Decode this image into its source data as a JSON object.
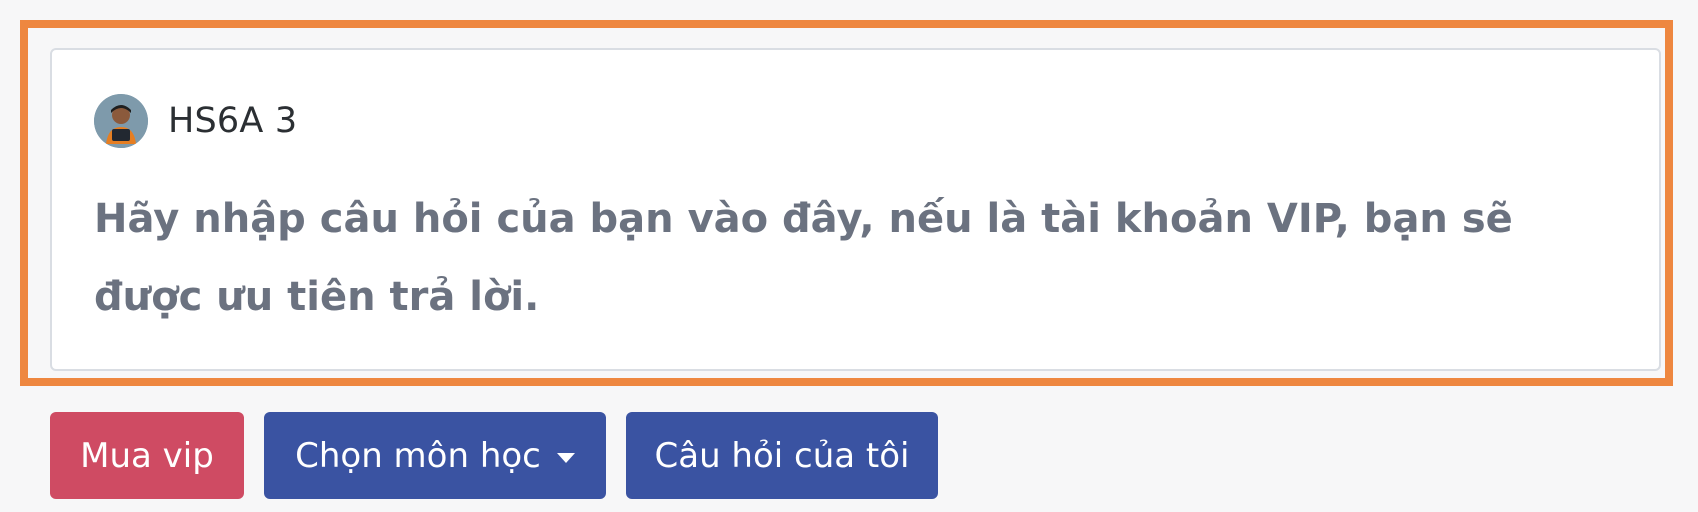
{
  "post": {
    "username": "HS6A 3",
    "avatar_icon": "student-avatar-icon",
    "placeholder_text": "Hãy nhập câu hỏi của bạn vào đây, nếu là tài khoản VIP, bạn sẽ được ưu tiên trả lời."
  },
  "actions": {
    "buy_vip": "Mua vip",
    "choose_subject": "Chọn môn học",
    "my_questions": "Câu hỏi của tôi"
  },
  "colors": {
    "highlight_border": "#ee8740",
    "vip_button": "#cf4b63",
    "primary_button": "#3a53a2"
  }
}
